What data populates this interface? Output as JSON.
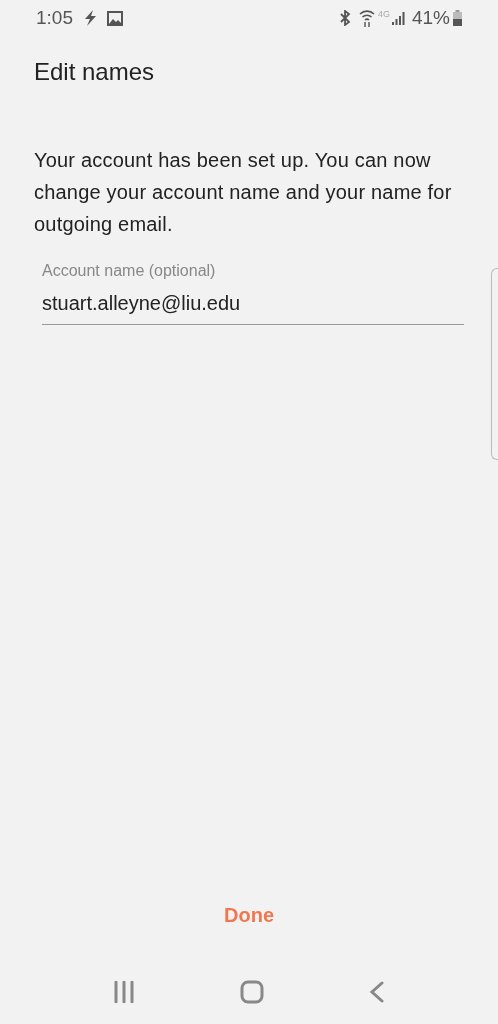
{
  "status_bar": {
    "time": "1:05",
    "network": "4G",
    "battery": "41%"
  },
  "title": "Edit names",
  "message": "Your account has been set up. You can now change your account name and your name for outgoing email.",
  "account_field": {
    "label": "Account name (optional)",
    "value": "stuart.alleyne@liu.edu"
  },
  "done_button": "Done"
}
